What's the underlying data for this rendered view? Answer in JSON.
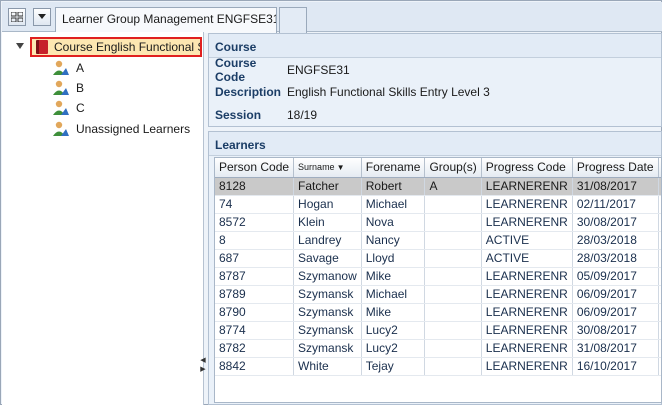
{
  "tabs": {
    "active_label": "Learner Group Management ENGFSE31"
  },
  "tree": {
    "root_label": "Course English Functional S",
    "items": [
      {
        "label": "A"
      },
      {
        "label": "B"
      },
      {
        "label": "C"
      },
      {
        "label": "Unassigned Learners"
      }
    ]
  },
  "course": {
    "header": "Course",
    "code_label": "Course Code",
    "code_value": "ENGFSE31",
    "desc_label": "Description",
    "desc_value": "English Functional Skills Entry Level 3",
    "session_label": "Session",
    "session_value": "18/19"
  },
  "learners": {
    "header": "Learners",
    "columns": [
      "Person Code",
      "Surname",
      "Forename",
      "Group(s)",
      "Progress Code",
      "Progress Date"
    ],
    "sorted_column": "Surname",
    "selected_row": 0,
    "rows": [
      [
        "8128",
        "Fatcher",
        "Robert",
        "A",
        "LEARNERENR",
        "31/08/2017"
      ],
      [
        "74",
        "Hogan",
        "Michael",
        "",
        "LEARNERENR",
        "02/11/2017"
      ],
      [
        "8572",
        "Klein",
        "Nova",
        "",
        "LEARNERENR",
        "30/08/2017"
      ],
      [
        "8",
        "Landrey",
        "Nancy",
        "",
        "ACTIVE",
        "28/03/2018"
      ],
      [
        "687",
        "Savage",
        "Lloyd",
        "",
        "ACTIVE",
        "28/03/2018"
      ],
      [
        "8787",
        "Szymanow",
        "Mike",
        "",
        "LEARNERENR",
        "05/09/2017"
      ],
      [
        "8789",
        "Szymansk",
        "Michael",
        "",
        "LEARNERENR",
        "06/09/2017"
      ],
      [
        "8790",
        "Szymansk",
        "Mike",
        "",
        "LEARNERENR",
        "06/09/2017"
      ],
      [
        "8774",
        "Szymansk",
        "Lucy2",
        "",
        "LEARNERENR",
        "30/08/2017"
      ],
      [
        "8782",
        "Szymansk",
        "Lucy2",
        "",
        "LEARNERENR",
        "31/08/2017"
      ],
      [
        "8842",
        "White",
        "Tejay",
        "",
        "LEARNERENR",
        "16/10/2017"
      ]
    ]
  },
  "colors": {
    "root_highlight": "#fde7b1",
    "root_border": "#e0201f",
    "selected_row": "#c9c9c9"
  },
  "icons": [
    "grid-menu-icon",
    "dropdown-arrow-icon",
    "expand-arrow-icon",
    "course-book-icon",
    "learner-group-icon",
    "collapse-left-icon",
    "expand-right-icon"
  ]
}
